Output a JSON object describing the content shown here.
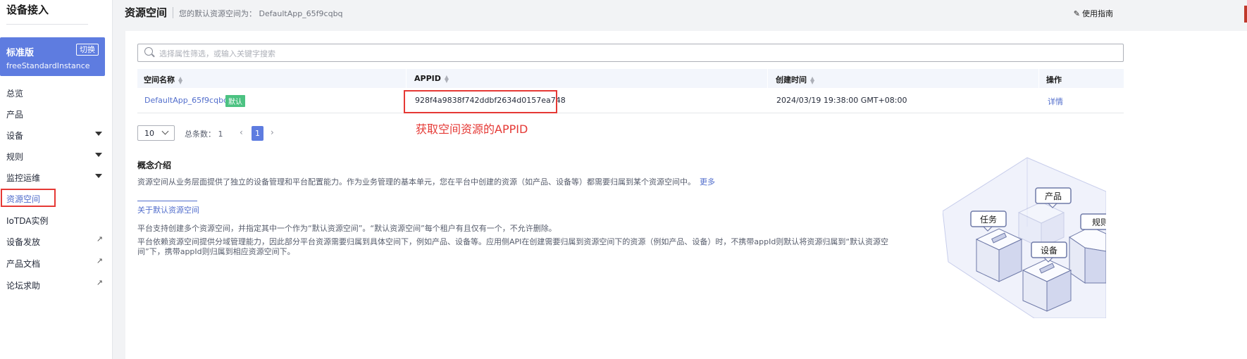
{
  "sidebar": {
    "title": "设备接入",
    "edition": {
      "name": "标准版",
      "switch_label": "切换",
      "instance": "freeStandardInstance"
    },
    "items": [
      {
        "label": "总览"
      },
      {
        "label": "产品"
      },
      {
        "label": "设备"
      },
      {
        "label": "规则"
      },
      {
        "label": "监控运维"
      },
      {
        "label": "资源空间"
      },
      {
        "label": "IoTDA实例"
      },
      {
        "label": "设备发放"
      },
      {
        "label": "产品文档"
      },
      {
        "label": "论坛求助"
      }
    ]
  },
  "header": {
    "title": "资源空间",
    "description": "您的默认资源空间为：  DefaultApp_65f9cqbq",
    "guide_label": "使用指南"
  },
  "search": {
    "placeholder": "选择属性筛选，或输入关键字搜索"
  },
  "table": {
    "columns": [
      "空间名称",
      "APPID",
      "创建时间",
      "操作"
    ],
    "rows": [
      {
        "name": "DefaultApp_65f9cqbq",
        "badge": "默认",
        "appid": "928f4a9838f742ddbf2634d0157ea748",
        "created": "2024/03/19 19:38:00 GMT+08:00",
        "action": "详情"
      }
    ]
  },
  "annotation": "获取空间资源的APPID",
  "pagination": {
    "page_size": "10",
    "total": "总条数：  1",
    "current": "1"
  },
  "concept": {
    "title": "概念介绍",
    "desc": "资源空间从业务层面提供了独立的设备管理和平台配置能力。作为业务管理的基本单元，您在平台中创建的资源（如产品、设备等）都需要归属到某个资源空间中。",
    "more": "更多",
    "tab": "关于默认资源空间",
    "p1": "平台支持创建多个资源空间，并指定其中一个作为“默认资源空间”。“默认资源空间”每个租户有且仅有一个，不允许删除。",
    "p2": "平台依赖资源空间提供分域管理能力，因此部分平台资源需要归属到具体空间下，例如产品、设备等。应用侧API在创建需要归属到资源空间下的资源（例如产品、设备）时，不携带appId则默认将资源归属到“默认资源空间”下，携带appId则归属到相应资源空间下。"
  },
  "illustration": {
    "labels": [
      "产品",
      "任务",
      "规则",
      "设备"
    ]
  },
  "colors": {
    "accent": "#5e7ce0",
    "link": "#526ecc",
    "highlight": "#e53935",
    "badge": "#4cc282"
  }
}
